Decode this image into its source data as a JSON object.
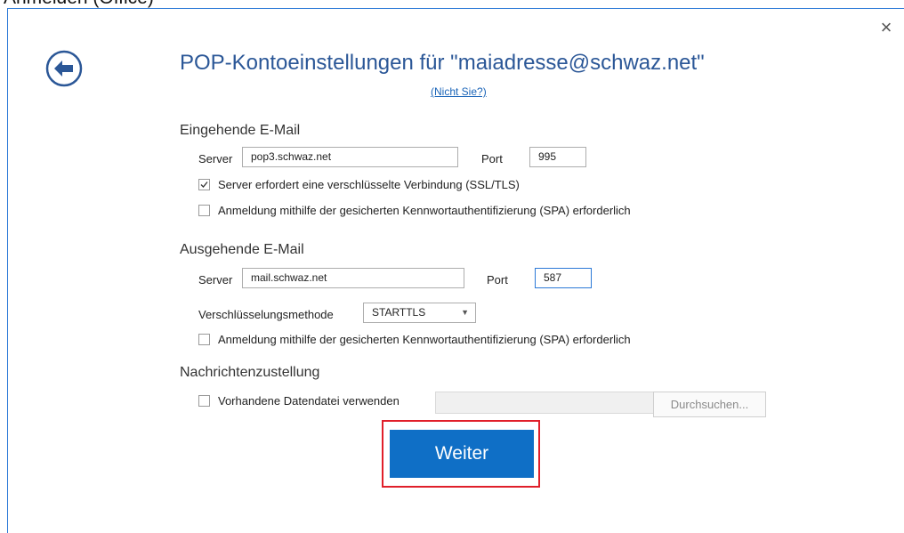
{
  "above_window_text": "Anmelden (Office)",
  "dialog": {
    "close_glyph": "×",
    "title": "POP-Kontoeinstellungen für \"maiadresse@schwaz.net\"",
    "not_you_link": "(Nicht Sie?)"
  },
  "incoming": {
    "heading": "Eingehende E-Mail",
    "server_label": "Server",
    "server_value": "pop3.schwaz.net",
    "port_label": "Port",
    "port_value": "995",
    "ssl_checkbox_label": "Server erfordert eine verschlüsselte Verbindung (SSL/TLS)",
    "ssl_checked": true,
    "spa_checkbox_label": "Anmeldung mithilfe der gesicherten Kennwortauthentifizierung (SPA) erforderlich",
    "spa_checked": false
  },
  "outgoing": {
    "heading": "Ausgehende E-Mail",
    "server_label": "Server",
    "server_value": "mail.schwaz.net",
    "port_label": "Port",
    "port_value": "587",
    "encryption_label": "Verschlüsselungsmethode",
    "encryption_value": "STARTTLS",
    "spa_checkbox_label": "Anmeldung mithilfe der gesicherten Kennwortauthentifizierung (SPA) erforderlich",
    "spa_checked": false
  },
  "delivery": {
    "heading": "Nachrichtenzustellung",
    "existing_file_label": "Vorhandene Datendatei verwenden",
    "existing_file_checked": false,
    "file_path_value": "",
    "browse_label": "Durchsuchen..."
  },
  "next_button_label": "Weiter",
  "colors": {
    "accent": "#2b79d7",
    "title": "#2b5797",
    "primary_button": "#0f6fc6",
    "highlight_frame": "#e01f2a"
  },
  "icons": {
    "back": "back-arrow-circle-icon",
    "close": "close-icon",
    "check": "checkmark-icon",
    "dropdown": "chevron-down-icon"
  }
}
